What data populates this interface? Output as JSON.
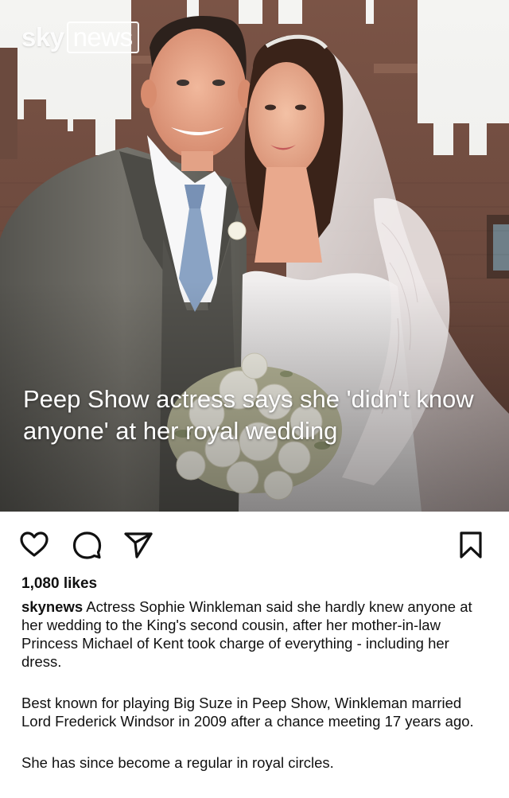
{
  "post": {
    "image": {
      "logo_brand": "sky",
      "logo_word": "news",
      "headline": "Peep Show actress says she 'didn't know anyone' at her royal wedding"
    },
    "actions": {
      "like_icon": "heart-icon",
      "comment_icon": "comment-bubble-icon",
      "share_icon": "paper-plane-icon",
      "save_icon": "bookmark-icon"
    },
    "likes": "1,080 likes",
    "caption": {
      "username": "skynews",
      "paragraphs": [
        "Actress Sophie Winkleman said she hardly knew anyone at her wedding to the King's second cousin, after her mother-in-law Princess Michael of Kent took charge of everything - including her dress.",
        "Best known for playing Big Suze in Peep Show, Winkleman married Lord Frederick Windsor in 2009 after a chance meeting 17 years ago.",
        "She has since become a regular in royal circles."
      ]
    }
  }
}
